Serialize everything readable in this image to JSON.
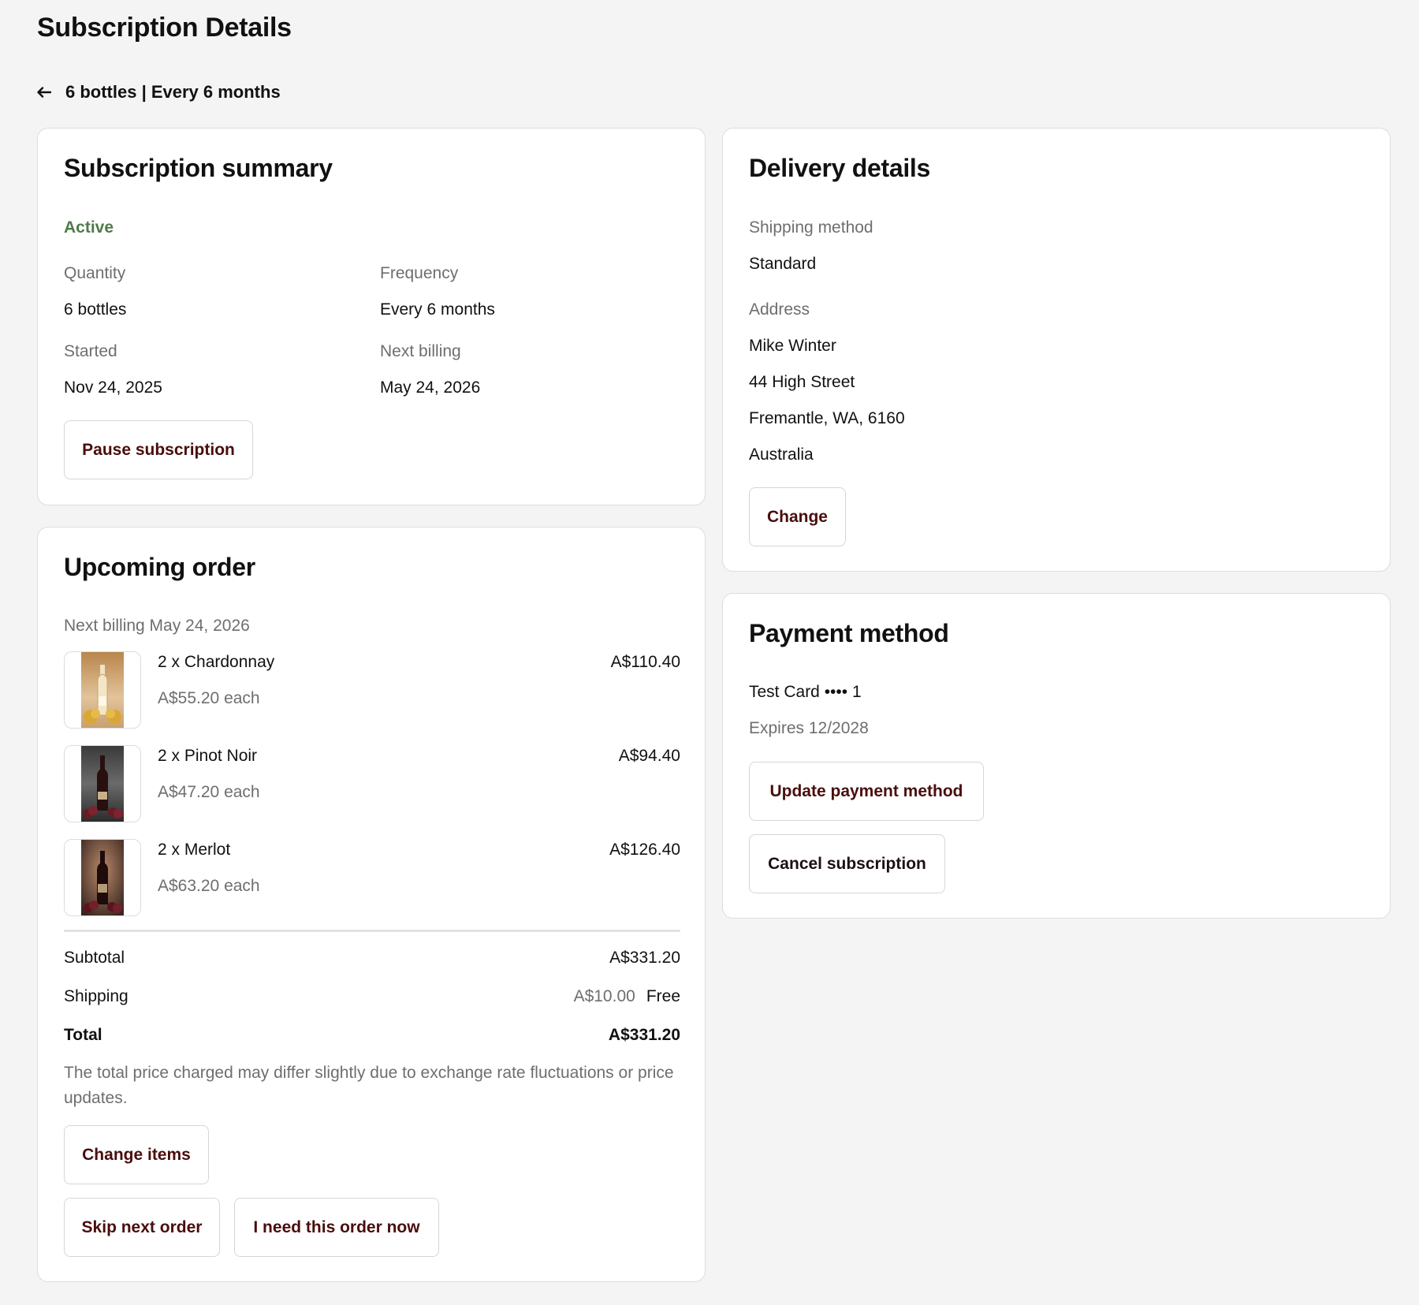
{
  "page": {
    "title": "Subscription Details",
    "back_label": "6 bottles | Every 6 months"
  },
  "summary": {
    "heading": "Subscription summary",
    "status": "Active",
    "quantity_label": "Quantity",
    "quantity_value": "6 bottles",
    "frequency_label": "Frequency",
    "frequency_value": "Every 6 months",
    "started_label": "Started",
    "started_value": "Nov 24, 2025",
    "next_billing_label": "Next billing",
    "next_billing_value": "May 24, 2026",
    "pause_button": "Pause subscription",
    "colors": {
      "active": "#4f7a4a",
      "button_text": "#4a0d0d"
    }
  },
  "upcoming": {
    "heading": "Upcoming order",
    "next_billing": "Next billing May 24, 2026",
    "items": [
      {
        "name": "2 x Chardonnay",
        "each": "A$55.20 each",
        "price": "A$110.40",
        "image": "chardonnay-bottle-image"
      },
      {
        "name": "2 x Pinot Noir",
        "each": "A$47.20 each",
        "price": "A$94.40",
        "image": "pinot-noir-bottle-image"
      },
      {
        "name": "2 x Merlot",
        "each": "A$63.20 each",
        "price": "A$126.40",
        "image": "merlot-bottle-image"
      }
    ],
    "subtotal_label": "Subtotal",
    "subtotal_value": "A$331.20",
    "shipping_label": "Shipping",
    "shipping_original": "A$10.00",
    "shipping_value": "Free",
    "total_label": "Total",
    "total_value": "A$331.20",
    "note": "The total price charged may differ slightly due to exchange rate fluctuations or price updates.",
    "change_items_button": "Change items",
    "skip_button": "Skip next order",
    "need_now_button": "I need this order now"
  },
  "delivery": {
    "heading": "Delivery details",
    "shipping_method_label": "Shipping method",
    "shipping_method_value": "Standard",
    "address_label": "Address",
    "address_lines": [
      "Mike Winter",
      "44 High Street",
      "Fremantle, WA, 6160",
      "Australia"
    ],
    "change_button": "Change"
  },
  "payment": {
    "heading": "Payment method",
    "card": "Test Card •••• 1",
    "expires": "Expires 12/2028",
    "update_button": "Update payment method",
    "cancel_button": "Cancel subscription"
  }
}
